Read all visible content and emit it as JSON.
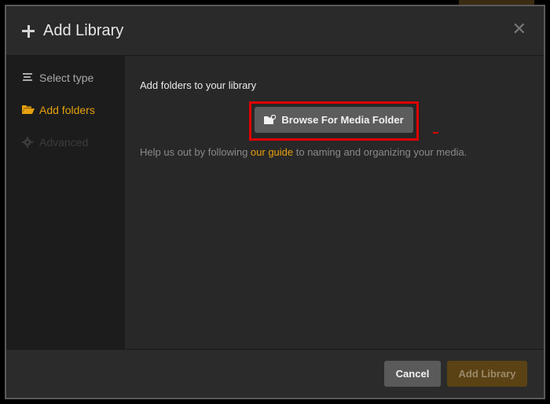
{
  "modal": {
    "title": "Add Library",
    "close_icon": "close-icon",
    "add_icon": "plus-icon"
  },
  "sidebar": {
    "items": [
      {
        "label": "Select type",
        "icon": "list-icon",
        "state": "default"
      },
      {
        "label": "Add folders",
        "icon": "folder-open-icon",
        "state": "active"
      },
      {
        "label": "Advanced",
        "icon": "gear-icon",
        "state": "disabled"
      }
    ]
  },
  "content": {
    "heading": "Add folders to your library",
    "browse_label": "Browse For Media Folder",
    "browse_icon": "folder-add-icon",
    "help_before": "Help us out by following ",
    "help_link": "our guide",
    "help_after": " to naming and organizing your media."
  },
  "footer": {
    "cancel_label": "Cancel",
    "add_label": "Add Library"
  },
  "colors": {
    "accent": "#e5a00d",
    "highlight": "#e00000",
    "panel": "#282828",
    "sidebar": "#1c1c1c"
  }
}
